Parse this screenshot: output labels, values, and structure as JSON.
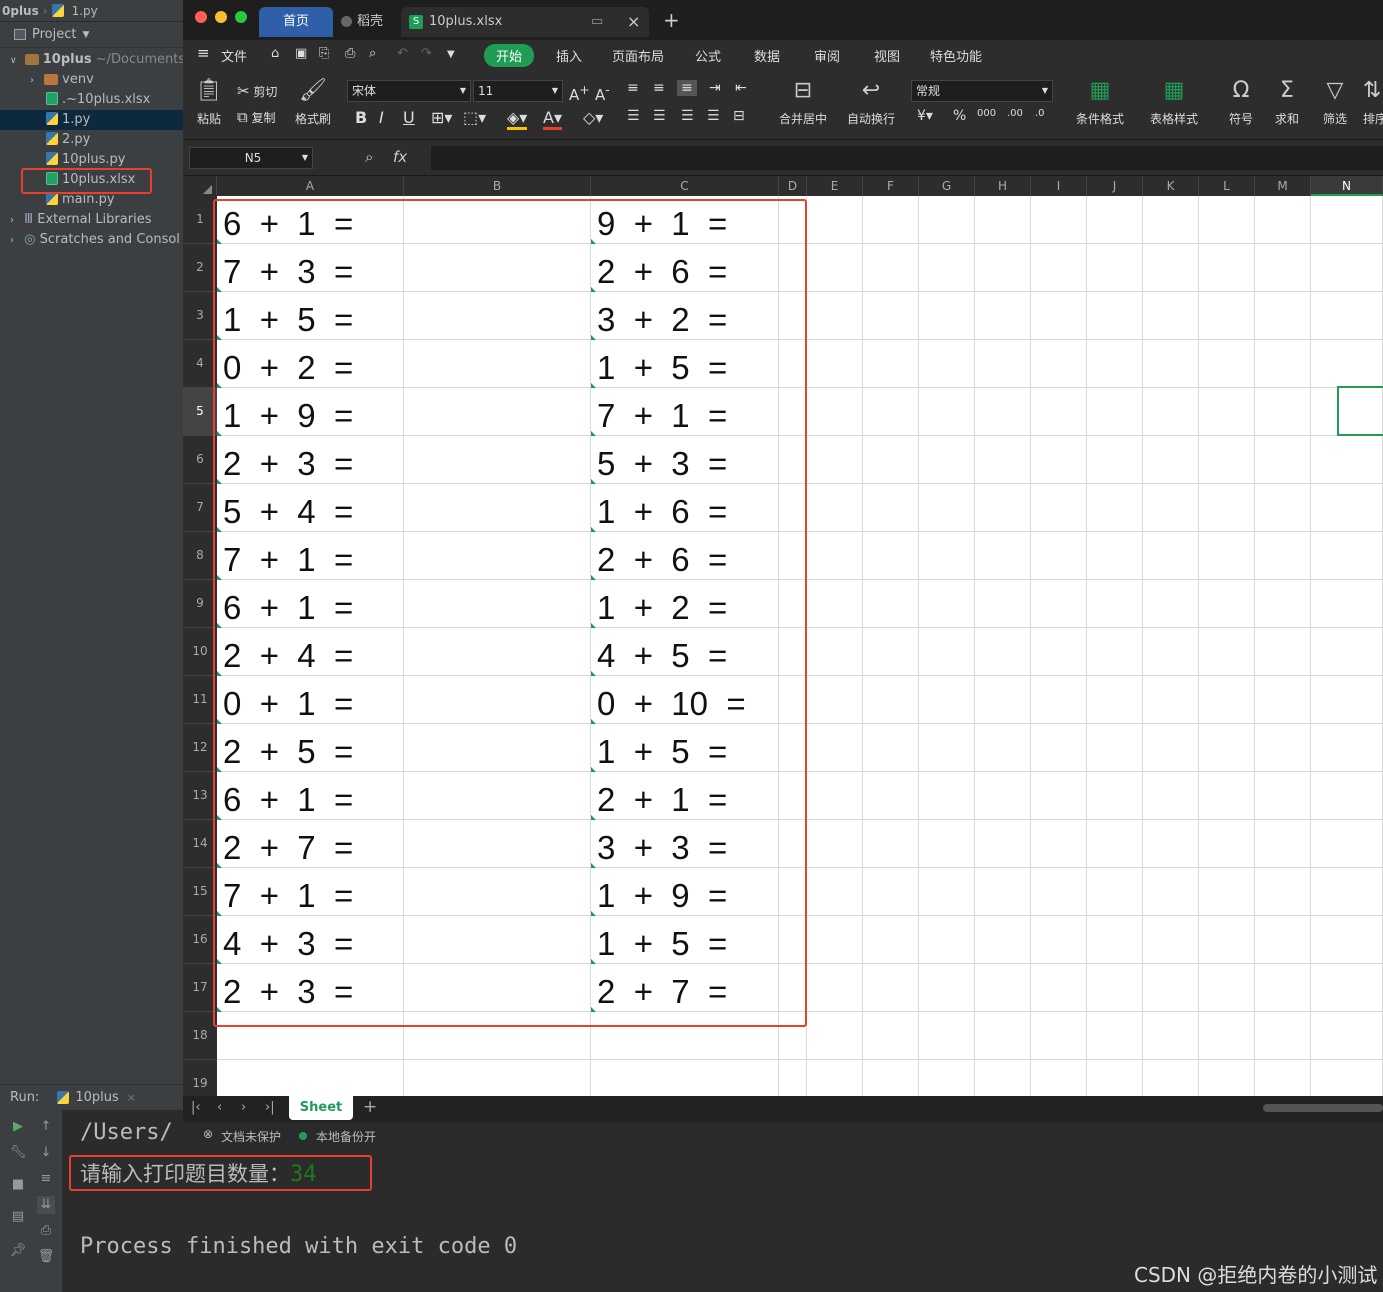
{
  "ide": {
    "breadcrumb": [
      "0plus",
      "1.py"
    ],
    "project_label": "Project",
    "tree": [
      {
        "label": "10plus",
        "extra": "~/Documents/",
        "type": "folder"
      },
      {
        "label": "venv",
        "type": "folder"
      },
      {
        "label": ".~10plus.xlsx",
        "type": "xls"
      },
      {
        "label": "1.py",
        "type": "py"
      },
      {
        "label": "2.py",
        "type": "py"
      },
      {
        "label": "10plus.py",
        "type": "py"
      },
      {
        "label": "10plus.xlsx",
        "type": "xls"
      },
      {
        "label": "main.py",
        "type": "py"
      },
      {
        "label": "External Libraries",
        "type": "lib"
      },
      {
        "label": "Scratches and Consol",
        "type": "scratch"
      }
    ],
    "run_label": "Run:",
    "run_config": "10plus",
    "console": {
      "path_line": "/Users/",
      "prompt": "请输入打印题目数量：",
      "input_value": "34",
      "finished": "Process finished with exit code 0"
    }
  },
  "wps": {
    "tabs": [
      {
        "label": "首页"
      },
      {
        "label": "稻壳"
      },
      {
        "label": "10plus.xlsx"
      }
    ],
    "menu": [
      "文件",
      "开始",
      "插入",
      "页面布局",
      "公式",
      "数据",
      "审阅",
      "视图",
      "特色功能"
    ],
    "menu_active": "开始",
    "ribbon": {
      "paste": "粘贴",
      "cut": "剪切",
      "copy": "复制",
      "format_painter": "格式刷",
      "font_name": "宋体",
      "font_size": "11",
      "merge_center": "合并居中",
      "wrap_text": "自动换行",
      "number_format": "常规",
      "conditional_format": "条件格式",
      "table_style": "表格样式",
      "symbol": "符号",
      "sum": "求和",
      "filter": "筛选",
      "sort": "排序"
    },
    "name_box": "N5",
    "fx": "fx",
    "columns": [
      "A",
      "B",
      "C",
      "D",
      "E",
      "F",
      "G",
      "H",
      "I",
      "J",
      "K",
      "L",
      "M",
      "N"
    ],
    "rows": [
      "1",
      "2",
      "3",
      "4",
      "5",
      "6",
      "7",
      "8",
      "9",
      "10",
      "11",
      "12",
      "13",
      "14",
      "15",
      "16",
      "17",
      "18",
      "19"
    ],
    "cells_a": [
      "6  +  1  =",
      "7  +  3  =",
      "1  +  5  =",
      "0  +  2  =",
      "1  +  9  =",
      "2  +  3  =",
      "5  +  4  =",
      "7  +  1  =",
      "6  +  1  =",
      "2  +  4  =",
      "0  +  1  =",
      "2  +  5  =",
      "6  +  1  =",
      "2  +  7  =",
      "7  +  1  =",
      "4  +  3  =",
      "2  +  3  ="
    ],
    "cells_c": [
      "9  +  1  =",
      "2  +  6  =",
      "3  +  2  =",
      "1  +  5  =",
      "7  +  1  =",
      "5  +  3  =",
      "1  +  6  =",
      "2  +  6  =",
      "1  +  2  =",
      "4  +  5  =",
      "0  +  10  =",
      "1  +  5  =",
      "2  +  1  =",
      "3  +  3  =",
      "1  +  9  =",
      "1  +  5  =",
      "2  +  7  ="
    ],
    "sheet_tab": "Sheet",
    "status_protect": "文档未保护",
    "status_backup": "本地备份开"
  },
  "watermark": "CSDN @拒绝内卷的小测试",
  "colors": {
    "accent_green": "#1f9d55",
    "highlight_red": "#e8402e",
    "tab_blue": "#2f5fa8"
  }
}
